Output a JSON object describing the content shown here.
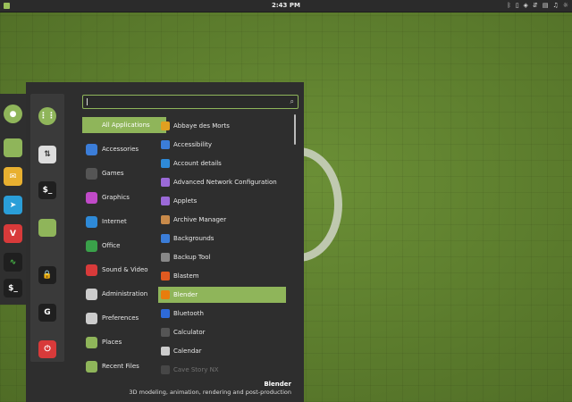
{
  "top_panel": {
    "clock": "2:43 PM"
  },
  "search": {
    "value": ""
  },
  "categories": [
    {
      "label": "All Applications",
      "color": "#8fb55a"
    },
    {
      "label": "Accessories",
      "color": "#3b7dd8"
    },
    {
      "label": "Games",
      "color": "#555555"
    },
    {
      "label": "Graphics",
      "color": "#c04ac8"
    },
    {
      "label": "Internet",
      "color": "#2e8ad8"
    },
    {
      "label": "Office",
      "color": "#3aa14a"
    },
    {
      "label": "Sound & Video",
      "color": "#d83a3a"
    },
    {
      "label": "Administration",
      "color": "#cccccc"
    },
    {
      "label": "Preferences",
      "color": "#cccccc"
    },
    {
      "label": "Places",
      "color": "#8fb55a"
    },
    {
      "label": "Recent Files",
      "color": "#8fb55a"
    }
  ],
  "apps": [
    {
      "label": "Abbaye des Morts",
      "color": "#e0a020"
    },
    {
      "label": "Accessibility",
      "color": "#3b7dd8"
    },
    {
      "label": "Account details",
      "color": "#2e8ad8"
    },
    {
      "label": "Advanced Network Configuration",
      "color": "#9b6ad8"
    },
    {
      "label": "Applets",
      "color": "#9b6ad8"
    },
    {
      "label": "Archive Manager",
      "color": "#c88a4a"
    },
    {
      "label": "Backgrounds",
      "color": "#3b7dd8"
    },
    {
      "label": "Backup Tool",
      "color": "#888888"
    },
    {
      "label": "Blastem",
      "color": "#e05a20"
    },
    {
      "label": "Blender",
      "color": "#e87d0d"
    },
    {
      "label": "Bluetooth",
      "color": "#2e6ad8"
    },
    {
      "label": "Calculator",
      "color": "#555555"
    },
    {
      "label": "Calendar",
      "color": "#cccccc"
    },
    {
      "label": "Cave Story NX",
      "color": "#777777"
    }
  ],
  "selected_app": {
    "name": "Blender",
    "description": "3D modeling, animation, rendering and post-production"
  }
}
